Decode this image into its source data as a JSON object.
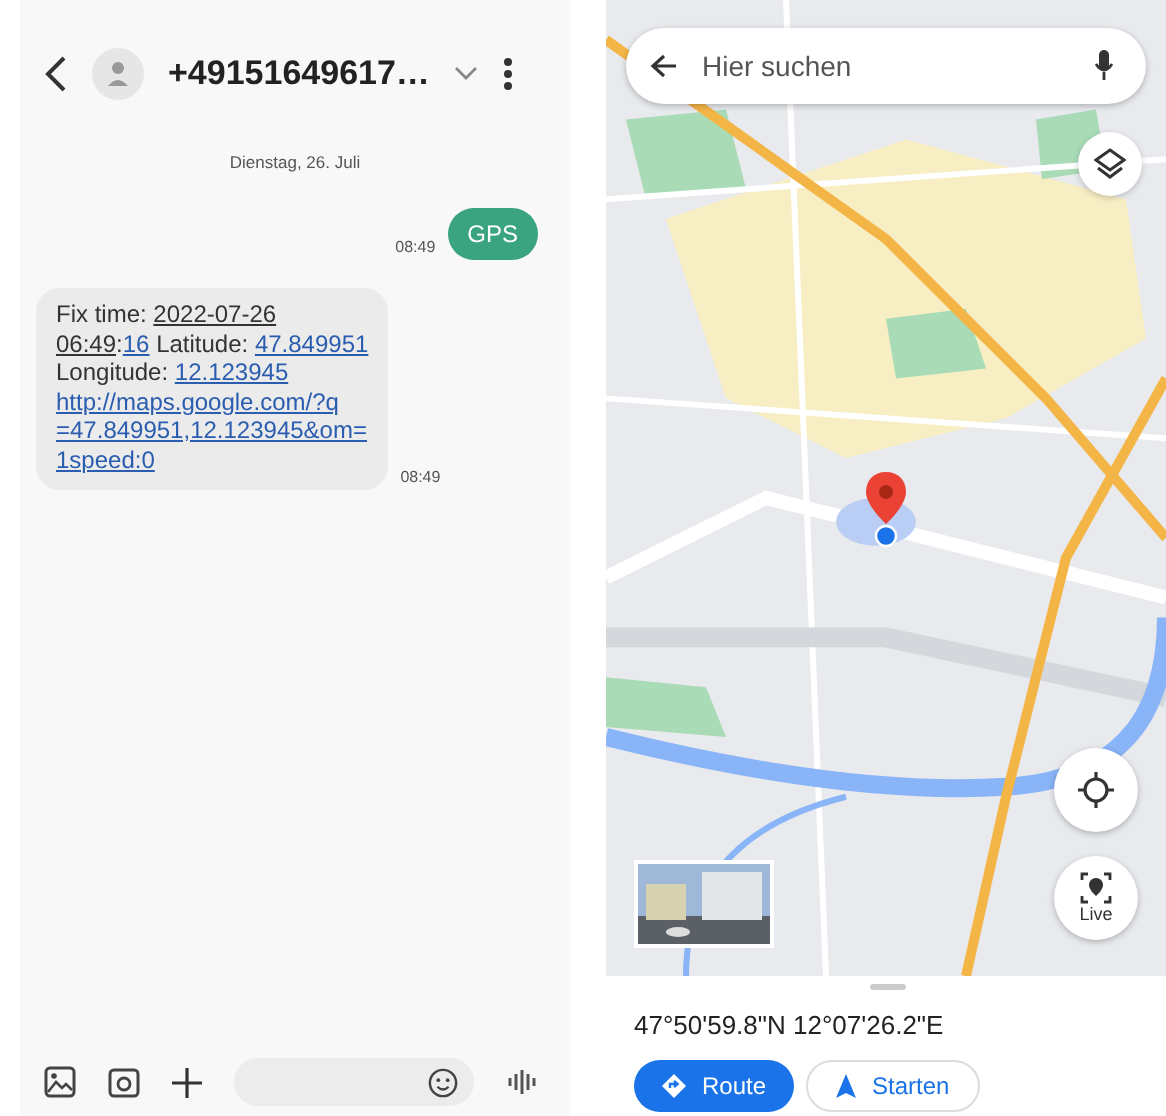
{
  "conversation": {
    "contact": "+49151649617…",
    "date": "Dienstag, 26. Juli",
    "messages": [
      {
        "kind": "outgoing",
        "text": "GPS",
        "time": "08:49"
      },
      {
        "kind": "incoming",
        "time": "08:49",
        "lines": [
          [
            {
              "kind": "plain",
              "text": "Fix time: "
            },
            {
              "kind": "date",
              "text": "2022-07-26"
            }
          ],
          [
            {
              "kind": "date",
              "text": "06:49"
            },
            {
              "kind": "plain",
              "text": ":"
            },
            {
              "kind": "link",
              "text": "16"
            },
            {
              "kind": "plain",
              "text": " Latitude: "
            },
            {
              "kind": "link",
              "text": "47.849951"
            }
          ],
          [
            {
              "kind": "plain",
              "text": "Longitude: "
            },
            {
              "kind": "link",
              "text": "12.123945"
            }
          ],
          [
            {
              "kind": "link",
              "text": "http://maps.google.com/?q"
            }
          ],
          [
            {
              "kind": "link",
              "text": "=47.849951,12.123945&om="
            }
          ],
          [
            {
              "kind": "link",
              "text": "1speed:0"
            }
          ]
        ]
      }
    ]
  },
  "map": {
    "search": {
      "placeholder": "Hier suchen"
    },
    "live_label": "Live",
    "place": {
      "coordinates": "47°50'59.8\"N 12°07'26.2\"E",
      "buttons": [
        {
          "label": "Route",
          "kind": "primary"
        },
        {
          "label": "Starten",
          "kind": "secondary"
        }
      ]
    }
  }
}
